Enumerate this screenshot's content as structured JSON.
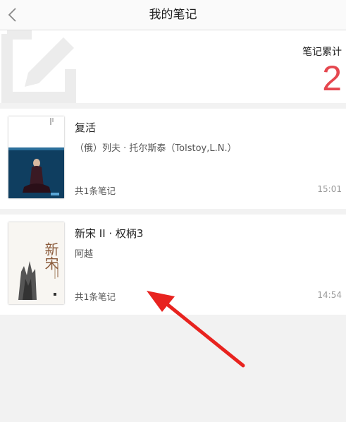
{
  "header": {
    "title": "我的笔记",
    "back_icon": "chevron-left-icon"
  },
  "summary": {
    "label": "笔记累计",
    "count": "2",
    "count_color": "#e5474f",
    "icon": "note-edit-icon"
  },
  "books": [
    {
      "title": "复活",
      "author": "（俄）列夫 · 托尔斯泰（Tolstoy,L.N.）",
      "notes": "共1条笔记",
      "time": "15:01"
    },
    {
      "title": "新宋 II · 权柄3",
      "author": "阿越",
      "notes": "共1条笔记",
      "time": "14:54",
      "cover_text": "新宋"
    }
  ],
  "annotation": {
    "type": "red-arrow",
    "color": "#e8231f"
  }
}
